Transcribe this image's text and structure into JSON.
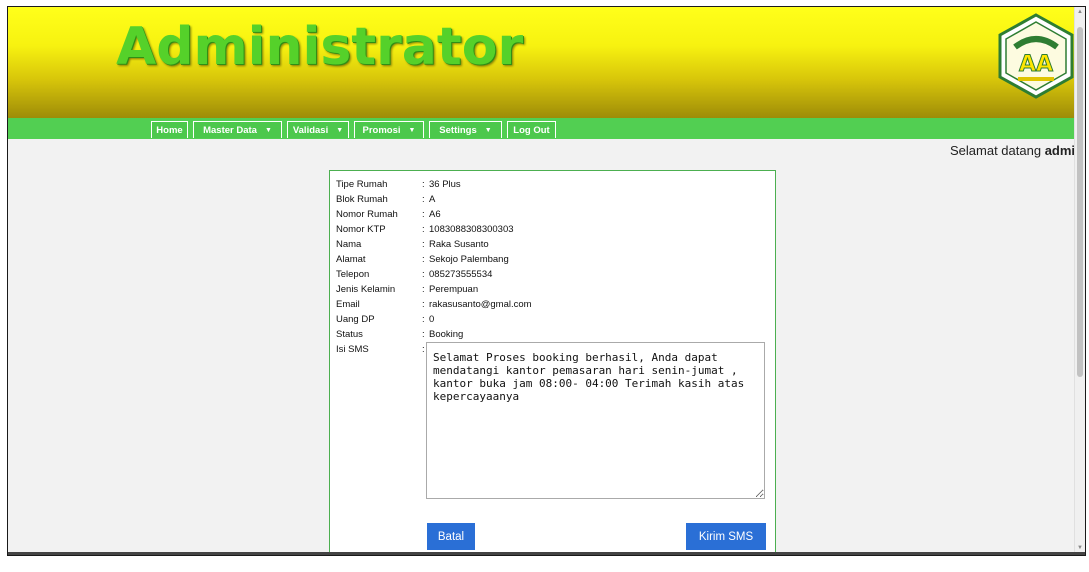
{
  "header": {
    "title": "Administrator",
    "logo_text": "AA"
  },
  "nav": [
    {
      "label": "Home",
      "dropdown": false
    },
    {
      "label": "Master Data",
      "dropdown": true
    },
    {
      "label": "Validasi",
      "dropdown": true
    },
    {
      "label": "Promosi",
      "dropdown": true
    },
    {
      "label": "Settings",
      "dropdown": true
    },
    {
      "label": "Log Out",
      "dropdown": false
    }
  ],
  "welcome": {
    "text": "Selamat datang",
    "user": "admin"
  },
  "form": {
    "fields": [
      {
        "label": "Tipe Rumah",
        "value": "36 Plus"
      },
      {
        "label": "Blok Rumah",
        "value": "A"
      },
      {
        "label": "Nomor Rumah",
        "value": "A6"
      },
      {
        "label": "Nomor KTP",
        "value": "1083088308300303"
      },
      {
        "label": "Nama",
        "value": "Raka Susanto"
      },
      {
        "label": "Alamat",
        "value": "Sekojo Palembang"
      },
      {
        "label": "Telepon",
        "value": "085273555534"
      },
      {
        "label": "Jenis Kelamin",
        "value": "Perempuan"
      },
      {
        "label": "Email",
        "value": "rakasusanto@gmal.com"
      },
      {
        "label": "Uang DP",
        "value": "0"
      },
      {
        "label": "Status",
        "value": "Booking"
      },
      {
        "label": "Isi SMS",
        "value": ""
      }
    ],
    "separator": ":",
    "sms_text": "Selamat Proses booking berhasil, Anda dapat mendatangi kantor pemasaran hari senin-jumat , kantor buka jam 08:00- 04:00 Terimah kasih atas kepercayaanya",
    "cancel_label": "Batal",
    "send_label": "Kirim SMS"
  },
  "colors": {
    "title": "#55d12a",
    "navbar": "#52cf52",
    "button": "#2a6fd6",
    "panel_border": "#4caf50"
  },
  "icons": {
    "caret": "caret-down-icon"
  }
}
